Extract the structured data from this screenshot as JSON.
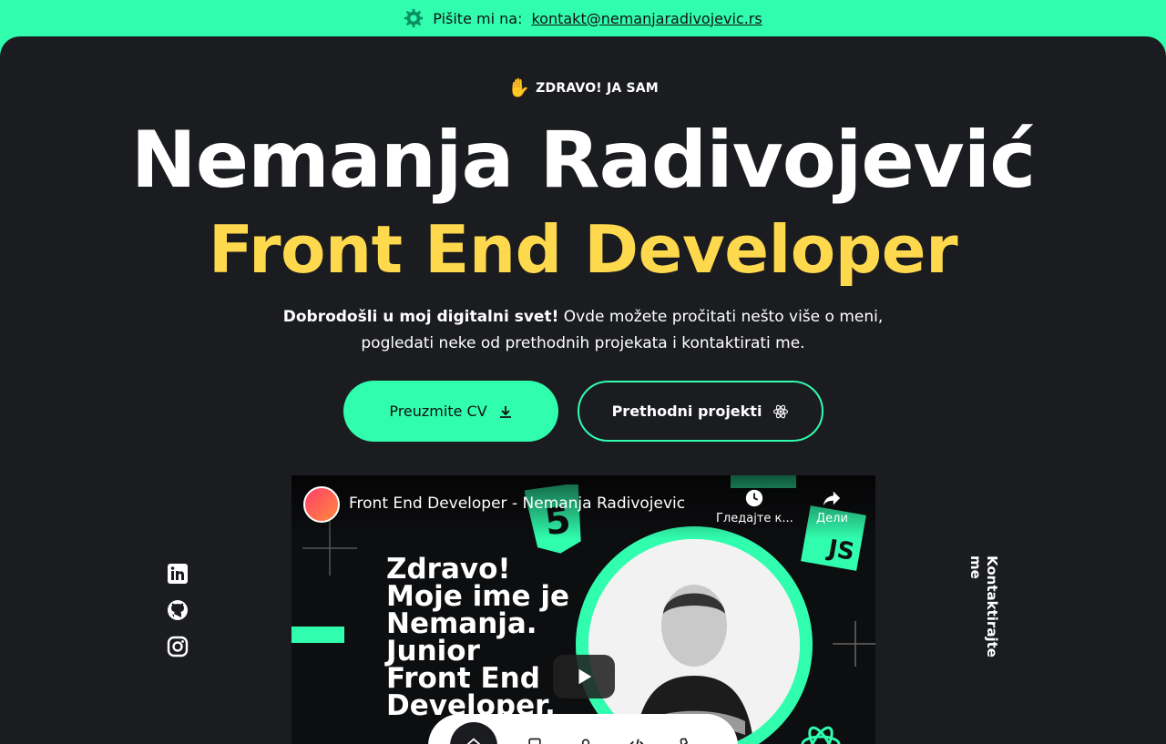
{
  "topbar": {
    "prefix": "Pišite mi na:",
    "email": "kontakt@nemanjaradivojevic.rs"
  },
  "hero": {
    "greeting": "ZDRAVO! JA SAM",
    "name": "Nemanja Radivojević",
    "role": "Front End Developer",
    "intro_bold": "Dobrodošli u moj digitalni svet!",
    "intro_line1_rest": " Ovde možete pročitati nešto više o meni,",
    "intro_line2": "pogledati neke od prethodnih projekata i kontaktirati me."
  },
  "buttons": {
    "cv": "Preuzmite CV",
    "projects": "Prethodni projekti"
  },
  "side_contact": "Kontaktirajte me",
  "video": {
    "title": "Front End Developer - Nemanja Radivojevic",
    "watch_later": "Гледајте к...",
    "share": "Дели",
    "thumbnail_text": [
      "Zdravo!",
      "Moje ime je",
      "Nemanja.",
      "Junior",
      "Front End",
      "Developer."
    ],
    "js_badge": "JS"
  },
  "colors": {
    "accent": "#31fdae",
    "yellow": "#ffd94d",
    "bg": "#1b1c20"
  }
}
